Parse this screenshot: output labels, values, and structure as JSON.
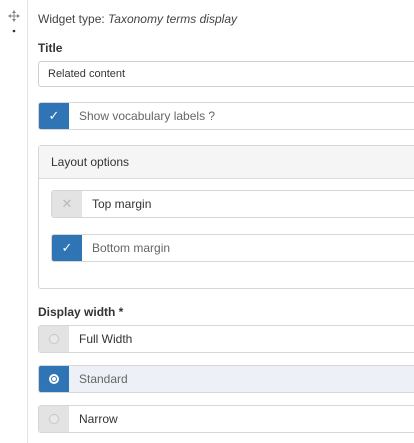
{
  "widget": {
    "type_prefix": "Widget type:",
    "type_name": "Taxonomy terms display"
  },
  "title_field": {
    "label": "Title",
    "value": "Related content"
  },
  "vocab_labels": {
    "label": "Show vocabulary labels ?",
    "checked": true
  },
  "layout_options": {
    "heading": "Layout options",
    "top_margin": {
      "label": "Top margin",
      "checked": false
    },
    "bottom_margin": {
      "label": "Bottom margin",
      "checked": true
    }
  },
  "display_width": {
    "label": "Display width *",
    "options": [
      {
        "label": "Full Width",
        "selected": false
      },
      {
        "label": "Standard",
        "selected": true
      },
      {
        "label": "Narrow",
        "selected": false
      }
    ]
  },
  "icons": {
    "check": "✓",
    "cross": "✕",
    "drag": "move-icon"
  },
  "colors": {
    "accent": "#2f74b5",
    "selected_row": "#edf0f7",
    "unchecked_box": "#e3e3e3"
  }
}
